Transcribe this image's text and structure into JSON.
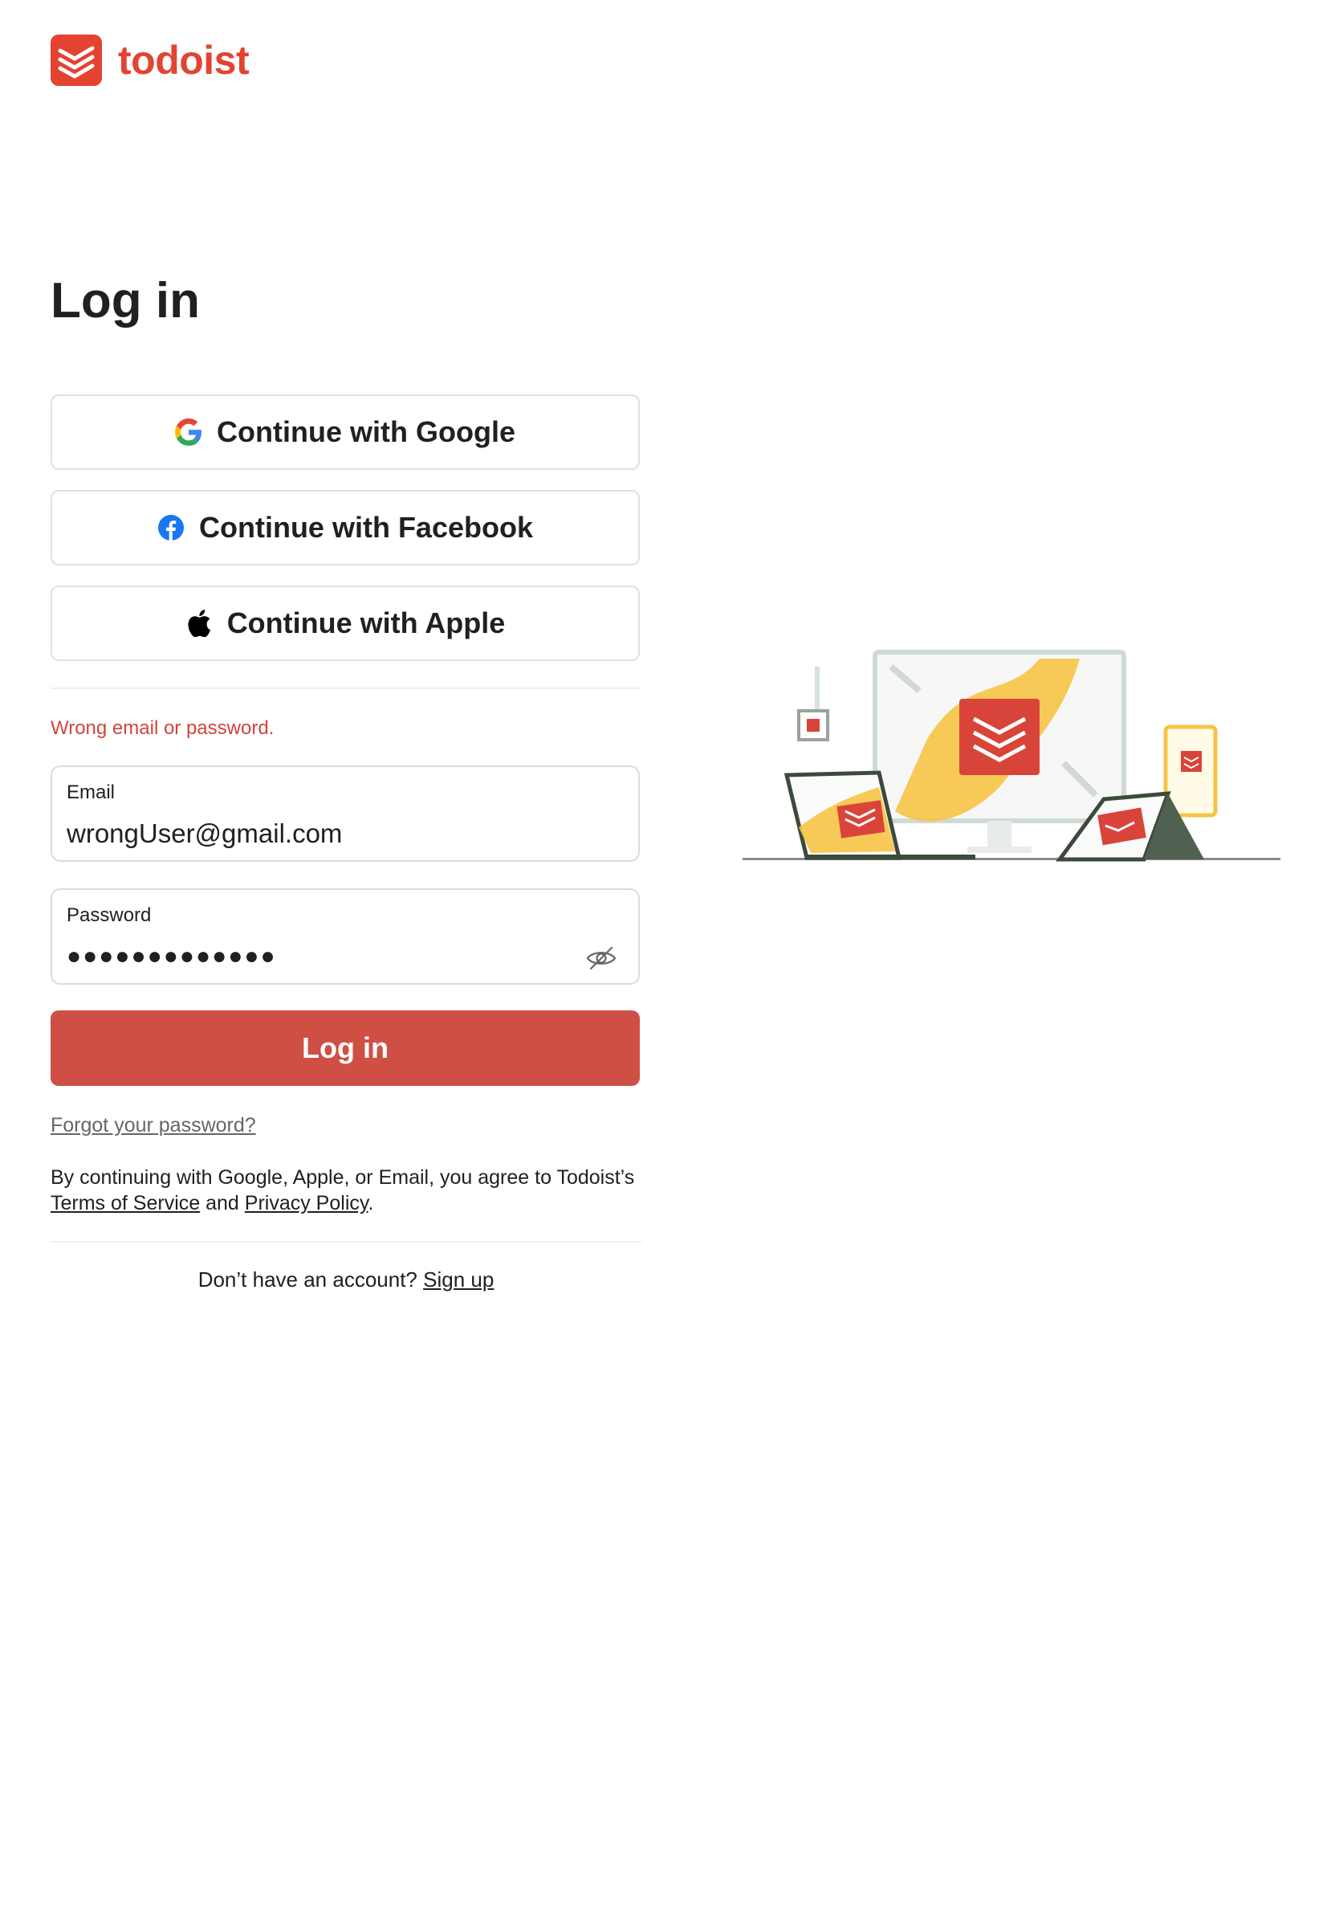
{
  "brand": {
    "name": "todoist",
    "color": "#e44332"
  },
  "page": {
    "title": "Log in"
  },
  "social": {
    "google_label": "Continue with Google",
    "facebook_label": "Continue with Facebook",
    "apple_label": "Continue with Apple"
  },
  "error": {
    "message": "Wrong email or password."
  },
  "form": {
    "email_label": "Email",
    "email_value": "wrongUser@gmail.com",
    "password_label": "Password",
    "password_masked": "●●●●●●●●●●●●●",
    "login_label": "Log in",
    "login_color": "#d04f44"
  },
  "links": {
    "forgot": "Forgot your password?"
  },
  "terms": {
    "prefix": "By continuing with Google, Apple, or Email, you agree to Todoist’s ",
    "tos": "Terms of Service",
    "middle": " and ",
    "privacy": "Privacy Policy",
    "suffix": "."
  },
  "signup": {
    "prompt": "Don’t have an account? ",
    "link": "Sign up"
  },
  "icons": {
    "google": "google-icon",
    "facebook": "facebook-icon",
    "apple": "apple-icon",
    "eye": "eye-off-icon"
  }
}
